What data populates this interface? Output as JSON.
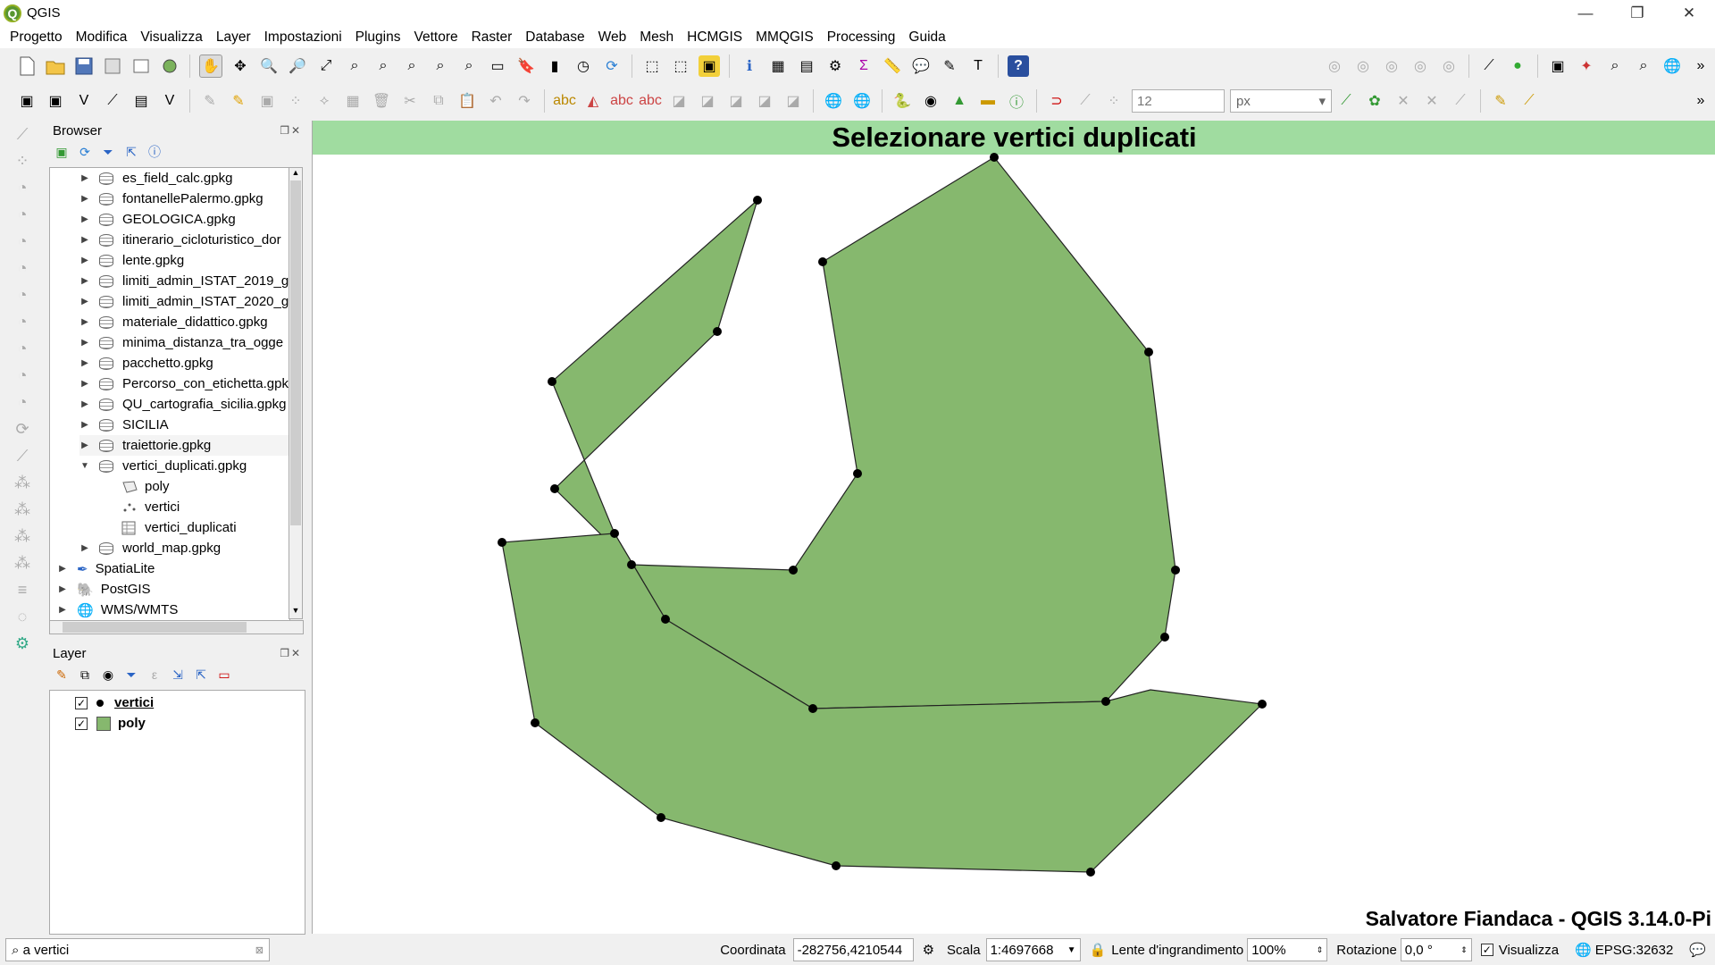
{
  "app": {
    "title": "QGIS"
  },
  "window_controls": {
    "minimize": "—",
    "restore": "❐",
    "close": "✕"
  },
  "menu": [
    "Progetto",
    "Modifica",
    "Visualizza",
    "Layer",
    "Impostazioni",
    "Plugins",
    "Vettore",
    "Raster",
    "Database",
    "Web",
    "Mesh",
    "HCMGIS",
    "MMQGIS",
    "Processing",
    "Guida"
  ],
  "toolbar2": {
    "size_value": "12",
    "unit_value": "px"
  },
  "browser": {
    "title": "Browser",
    "items": [
      {
        "label": "es_field_calc.gpkg"
      },
      {
        "label": "fontanellePalermo.gpkg"
      },
      {
        "label": "GEOLOGICA.gpkg"
      },
      {
        "label": "itinerario_cicloturistico_dor"
      },
      {
        "label": "lente.gpkg"
      },
      {
        "label": "limiti_admin_ISTAT_2019_g"
      },
      {
        "label": "limiti_admin_ISTAT_2020_g"
      },
      {
        "label": "materiale_didattico.gpkg"
      },
      {
        "label": "minima_distanza_tra_ogge"
      },
      {
        "label": "pacchetto.gpkg"
      },
      {
        "label": "Percorso_con_etichetta.gpk"
      },
      {
        "label": "QU_cartografia_sicilia.gpkg"
      },
      {
        "label": "SICILIA"
      },
      {
        "label": "traiettorie.gpkg"
      },
      {
        "label": "vertici_duplicati.gpkg"
      }
    ],
    "children": [
      {
        "label": "poly"
      },
      {
        "label": "vertici"
      },
      {
        "label": "vertici_duplicati"
      }
    ],
    "after": [
      {
        "label": "world_map.gpkg"
      }
    ],
    "roots": [
      {
        "label": "SpatiaLite"
      },
      {
        "label": "PostGIS"
      },
      {
        "label": "WMS/WMTS"
      }
    ]
  },
  "layers": {
    "title": "Layer",
    "items": [
      {
        "label": "vertici"
      },
      {
        "label": "poly"
      }
    ]
  },
  "map": {
    "banner": "Selezionare vertici duplicati",
    "credit": "Salvatore Fiandaca - QGIS 3.14.0-Pi",
    "fill_color": "#86b86e",
    "banner_color": "#a0dca0"
  },
  "status": {
    "locator_value": "a vertici",
    "coord_label": "Coordinata",
    "coord_value": "-282756,4210544",
    "scale_label": "Scala",
    "scale_value": "1:4697668",
    "magnifier_label": "Lente d'ingrandimento",
    "magnifier_value": "100%",
    "rotation_label": "Rotazione",
    "rotation_value": "0,0 °",
    "render_label": "Visualizza",
    "crs": "EPSG:32632"
  }
}
